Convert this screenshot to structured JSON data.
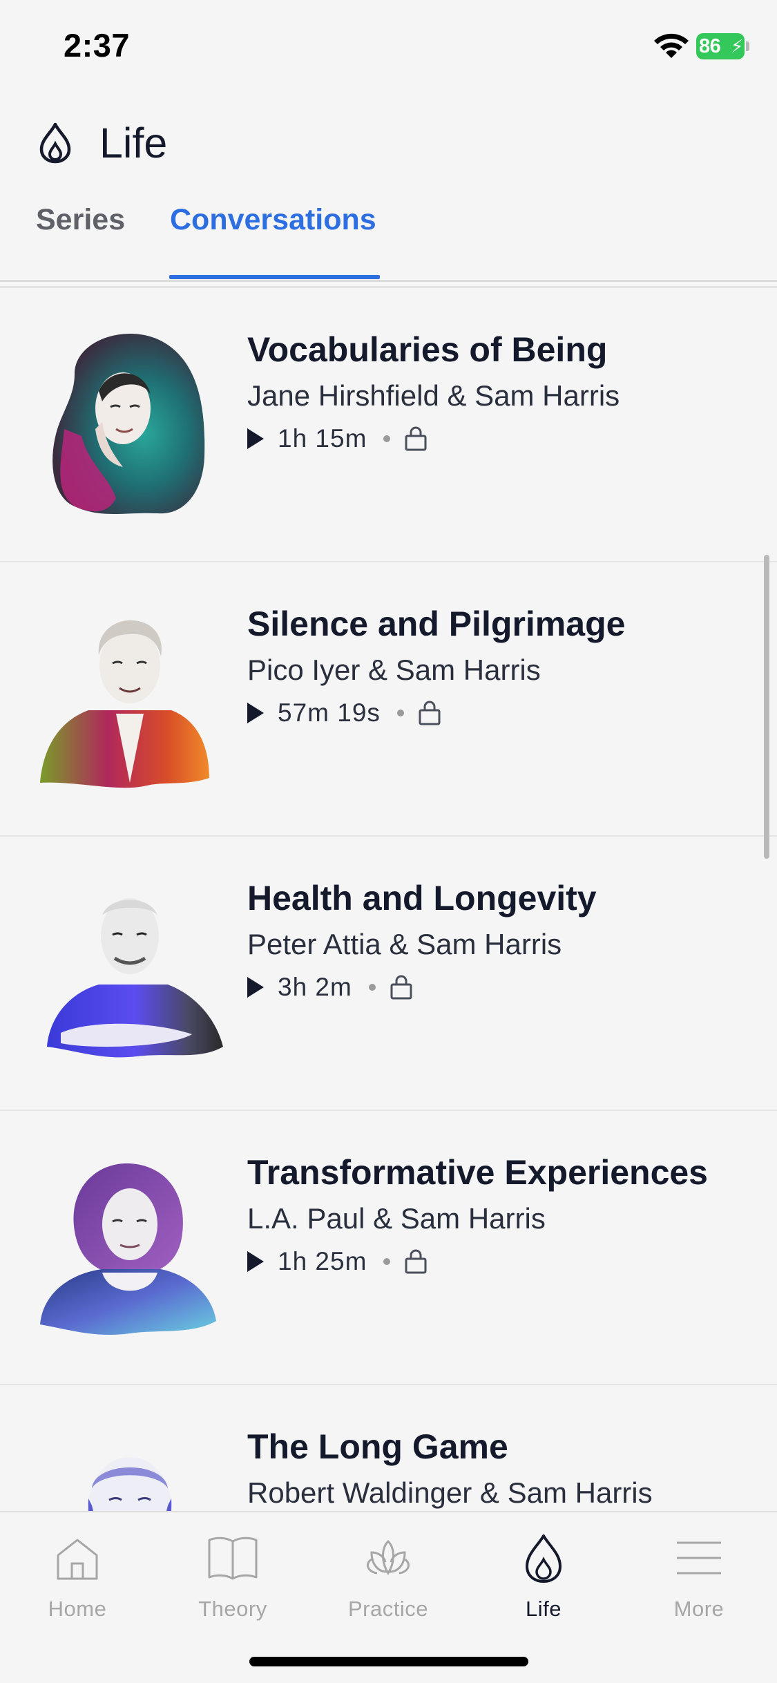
{
  "status_bar": {
    "time": "2:37",
    "battery": "86"
  },
  "header": {
    "title": "Life"
  },
  "tabs": [
    {
      "label": "Series",
      "active": false
    },
    {
      "label": "Conversations",
      "active": true
    }
  ],
  "conversations": [
    {
      "title": "Vocabularies of Being",
      "authors": "Jane Hirshfield & Sam Harris",
      "duration": "1h 15m",
      "locked": true
    },
    {
      "title": "Silence and Pilgrimage",
      "authors": "Pico Iyer & Sam Harris",
      "duration": "57m 19s",
      "locked": true
    },
    {
      "title": "Health and Longevity",
      "authors": "Peter Attia & Sam Harris",
      "duration": "3h 2m",
      "locked": true
    },
    {
      "title": "Transformative Experiences",
      "authors": "L.A. Paul & Sam Harris",
      "duration": "1h 25m",
      "locked": true
    },
    {
      "title": "The Long Game",
      "authors": "Robert Waldinger & Sam Harris"
    }
  ],
  "bottom_nav": [
    {
      "label": "Home",
      "icon": "home-icon"
    },
    {
      "label": "Theory",
      "icon": "book-icon"
    },
    {
      "label": "Practice",
      "icon": "lotus-icon"
    },
    {
      "label": "Life",
      "icon": "flame-icon",
      "active": true
    },
    {
      "label": "More",
      "icon": "menu-icon"
    }
  ],
  "colors": {
    "accent": "#2d6fe0",
    "text": "#141a2c",
    "inactive": "#a6a6a6",
    "battery": "#34c759"
  }
}
